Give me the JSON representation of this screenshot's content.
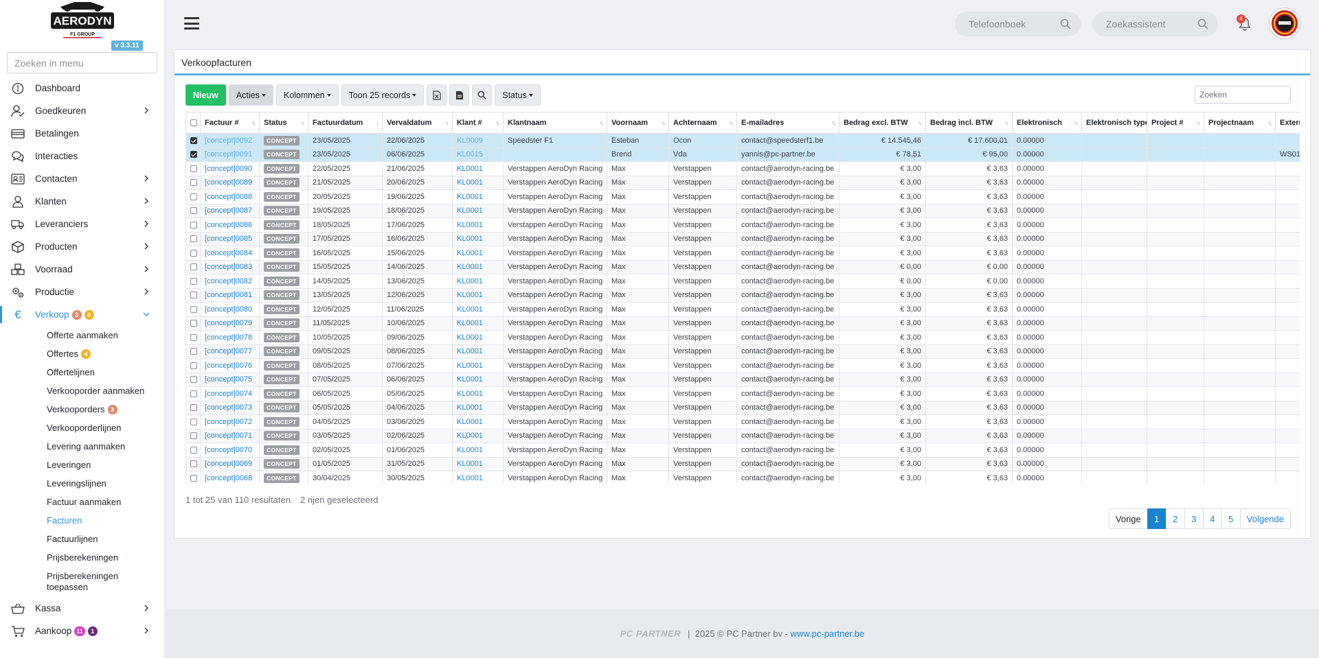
{
  "app": {
    "logo_text": "AERODYN",
    "logo_sub": "F1 GROUP",
    "version": "v 3.3.11",
    "menu_search_placeholder": "Zoeken in menu"
  },
  "sidebar": {
    "items": [
      {
        "label": "Dashboard",
        "icon": "dashboard-icon",
        "chevron": false
      },
      {
        "label": "Goedkeuren",
        "icon": "user-check-icon",
        "chevron": true
      },
      {
        "label": "Betalingen",
        "icon": "card-icon",
        "chevron": false
      },
      {
        "label": "Interacties",
        "icon": "chat-icon",
        "chevron": false
      },
      {
        "label": "Contacten",
        "icon": "contact-card-icon",
        "chevron": true
      },
      {
        "label": "Klanten",
        "icon": "user-icon",
        "chevron": true
      },
      {
        "label": "Leveranciers",
        "icon": "truck-icon",
        "chevron": true
      },
      {
        "label": "Producten",
        "icon": "box-icon",
        "chevron": true
      },
      {
        "label": "Voorraad",
        "icon": "boxes-icon",
        "chevron": true
      },
      {
        "label": "Productie",
        "icon": "gears-icon",
        "chevron": true
      }
    ],
    "verkoop": {
      "label": "Verkoop",
      "badge1": "3",
      "badge2": "4"
    },
    "subitems": [
      {
        "label": "Offerte aanmaken"
      },
      {
        "label": "Offertes",
        "badge": "4",
        "badge_color": "#f0b429"
      },
      {
        "label": "Offertelijnen"
      },
      {
        "label": "Verkooporder aanmaken"
      },
      {
        "label": "Verkooporders",
        "badge": "3",
        "badge_color": "#e08a6b"
      },
      {
        "label": "Verkooporderlijnen"
      },
      {
        "label": "Levering aanmaken"
      },
      {
        "label": "Leveringen"
      },
      {
        "label": "Leveringslijnen"
      },
      {
        "label": "Factuur aanmaken"
      },
      {
        "label": "Facturen",
        "active": true
      },
      {
        "label": "Factuurlijnen"
      },
      {
        "label": "Prijsberekeningen"
      },
      {
        "label": "Prijsberekeningen toepassen"
      }
    ],
    "kassa": {
      "label": "Kassa"
    },
    "aankoop": {
      "label": "Aankoop",
      "badge1": "11",
      "badge2": "1"
    }
  },
  "topbar": {
    "phonebook_placeholder": "Telefoonboek",
    "assistant_placeholder": "Zoekassistent",
    "notification_count": "4"
  },
  "page": {
    "title": "Verkoopfacturen",
    "toolbar": {
      "new": "Nieuw",
      "actions": "Acties",
      "columns": "Kolommen",
      "show": "Toon 25 records",
      "status": "Status"
    },
    "search_placeholder": "Zoeken",
    "columns": [
      "Factuur #",
      "Status",
      "Factuurdatum",
      "Vervaldatum",
      "Klant #",
      "Klantnaam",
      "Voornaam",
      "Achternaam",
      "E-mailadres",
      "Bedrag excl. BTW",
      "Bedrag incl. BTW",
      "Elektronisch",
      "Elektronisch type",
      "Project #",
      "Projectnaam",
      "Externe"
    ],
    "rows": [
      {
        "sel": true,
        "inv": "[concept]0092",
        "status": "CONCEPT",
        "date": "23/05/2025",
        "due": "22/06/2025",
        "client": "KL0009",
        "cname": "Speedster F1",
        "first": "Esteban",
        "last": "Ocon",
        "email": "contact@speedsterf1.be",
        "excl": "€ 14.545,46",
        "incl": "€ 17.600,01",
        "el": "0.00000",
        "ext": ""
      },
      {
        "sel": true,
        "inv": "[concept]0091",
        "status": "CONCEPT",
        "date": "23/05/2025",
        "due": "06/06/2025",
        "client": "KL0015",
        "cname": "",
        "first": "Brend",
        "last": "Vda",
        "email": "yannis@pc-partner.be",
        "excl": "€ 78,51",
        "incl": "€ 95,00",
        "el": "0.00000",
        "ext": "WS01"
      },
      {
        "inv": "[concept]0090",
        "status": "CONCEPT",
        "date": "22/05/2025",
        "due": "21/06/2025",
        "client": "KL0001",
        "cname": "Verstappen AeroDyn Racing",
        "first": "Max",
        "last": "Verstappen",
        "email": "contact@aerodyn-racing.be",
        "excl": "€ 3,00",
        "incl": "€ 3,63",
        "el": "0.00000",
        "ext": ""
      },
      {
        "inv": "[concept]0089",
        "status": "CONCEPT",
        "date": "21/05/2025",
        "due": "20/06/2025",
        "client": "KL0001",
        "cname": "Verstappen AeroDyn Racing",
        "first": "Max",
        "last": "Verstappen",
        "email": "contact@aerodyn-racing.be",
        "excl": "€ 3,00",
        "incl": "€ 3,63",
        "el": "0.00000",
        "ext": ""
      },
      {
        "inv": "[concept]0088",
        "status": "CONCEPT",
        "date": "20/05/2025",
        "due": "19/06/2025",
        "client": "KL0001",
        "cname": "Verstappen AeroDyn Racing",
        "first": "Max",
        "last": "Verstappen",
        "email": "contact@aerodyn-racing.be",
        "excl": "€ 3,00",
        "incl": "€ 3,63",
        "el": "0.00000",
        "ext": ""
      },
      {
        "inv": "[concept]0087",
        "status": "CONCEPT",
        "date": "19/05/2025",
        "due": "18/06/2025",
        "client": "KL0001",
        "cname": "Verstappen AeroDyn Racing",
        "first": "Max",
        "last": "Verstappen",
        "email": "contact@aerodyn-racing.be",
        "excl": "€ 3,00",
        "incl": "€ 3,63",
        "el": "0.00000",
        "ext": ""
      },
      {
        "inv": "[concept]0086",
        "status": "CONCEPT",
        "date": "18/05/2025",
        "due": "17/06/2025",
        "client": "KL0001",
        "cname": "Verstappen AeroDyn Racing",
        "first": "Max",
        "last": "Verstappen",
        "email": "contact@aerodyn-racing.be",
        "excl": "€ 3,00",
        "incl": "€ 3,63",
        "el": "0.00000",
        "ext": ""
      },
      {
        "inv": "[concept]0085",
        "status": "CONCEPT",
        "date": "17/05/2025",
        "due": "16/06/2025",
        "client": "KL0001",
        "cname": "Verstappen AeroDyn Racing",
        "first": "Max",
        "last": "Verstappen",
        "email": "contact@aerodyn-racing.be",
        "excl": "€ 3,00",
        "incl": "€ 3,63",
        "el": "0.00000",
        "ext": ""
      },
      {
        "inv": "[concept]0084",
        "status": "CONCEPT",
        "date": "16/05/2025",
        "due": "15/06/2025",
        "client": "KL0001",
        "cname": "Verstappen AeroDyn Racing",
        "first": "Max",
        "last": "Verstappen",
        "email": "contact@aerodyn-racing.be",
        "excl": "€ 3,00",
        "incl": "€ 3,63",
        "el": "0.00000",
        "ext": ""
      },
      {
        "inv": "[concept]0083",
        "status": "CONCEPT",
        "date": "15/05/2025",
        "due": "14/06/2025",
        "client": "KL0001",
        "cname": "Verstappen AeroDyn Racing",
        "first": "Max",
        "last": "Verstappen",
        "email": "contact@aerodyn-racing.be",
        "excl": "€ 0,00",
        "incl": "€ 0,00",
        "el": "0.00000",
        "ext": ""
      },
      {
        "inv": "[concept]0082",
        "status": "CONCEPT",
        "date": "14/05/2025",
        "due": "13/06/2025",
        "client": "KL0001",
        "cname": "Verstappen AeroDyn Racing",
        "first": "Max",
        "last": "Verstappen",
        "email": "contact@aerodyn-racing.be",
        "excl": "€ 0,00",
        "incl": "€ 0,00",
        "el": "0.00000",
        "ext": ""
      },
      {
        "inv": "[concept]0081",
        "status": "CONCEPT",
        "date": "13/05/2025",
        "due": "12/06/2025",
        "client": "KL0001",
        "cname": "Verstappen AeroDyn Racing",
        "first": "Max",
        "last": "Verstappen",
        "email": "contact@aerodyn-racing.be",
        "excl": "€ 3,00",
        "incl": "€ 3,63",
        "el": "0.00000",
        "ext": ""
      },
      {
        "inv": "[concept]0080",
        "status": "CONCEPT",
        "date": "12/05/2025",
        "due": "11/06/2025",
        "client": "KL0001",
        "cname": "Verstappen AeroDyn Racing",
        "first": "Max",
        "last": "Verstappen",
        "email": "contact@aerodyn-racing.be",
        "excl": "€ 3,00",
        "incl": "€ 3,63",
        "el": "0.00000",
        "ext": ""
      },
      {
        "inv": "[concept]0079",
        "status": "CONCEPT",
        "date": "11/05/2025",
        "due": "10/06/2025",
        "client": "KL0001",
        "cname": "Verstappen AeroDyn Racing",
        "first": "Max",
        "last": "Verstappen",
        "email": "contact@aerodyn-racing.be",
        "excl": "€ 3,00",
        "incl": "€ 3,63",
        "el": "0.00000",
        "ext": ""
      },
      {
        "inv": "[concept]0078",
        "status": "CONCEPT",
        "date": "10/05/2025",
        "due": "09/06/2025",
        "client": "KL0001",
        "cname": "Verstappen AeroDyn Racing",
        "first": "Max",
        "last": "Verstappen",
        "email": "contact@aerodyn-racing.be",
        "excl": "€ 3,00",
        "incl": "€ 3,63",
        "el": "0.00000",
        "ext": ""
      },
      {
        "inv": "[concept]0077",
        "status": "CONCEPT",
        "date": "09/05/2025",
        "due": "08/06/2025",
        "client": "KL0001",
        "cname": "Verstappen AeroDyn Racing",
        "first": "Max",
        "last": "Verstappen",
        "email": "contact@aerodyn-racing.be",
        "excl": "€ 3,00",
        "incl": "€ 3,63",
        "el": "0.00000",
        "ext": ""
      },
      {
        "inv": "[concept]0076",
        "status": "CONCEPT",
        "date": "08/05/2025",
        "due": "07/06/2025",
        "client": "KL0001",
        "cname": "Verstappen AeroDyn Racing",
        "first": "Max",
        "last": "Verstappen",
        "email": "contact@aerodyn-racing.be",
        "excl": "€ 3,00",
        "incl": "€ 3,63",
        "el": "0.00000",
        "ext": ""
      },
      {
        "inv": "[concept]0075",
        "status": "CONCEPT",
        "date": "07/05/2025",
        "due": "06/06/2025",
        "client": "KL0001",
        "cname": "Verstappen AeroDyn Racing",
        "first": "Max",
        "last": "Verstappen",
        "email": "contact@aerodyn-racing.be",
        "excl": "€ 3,00",
        "incl": "€ 3,63",
        "el": "0.00000",
        "ext": ""
      },
      {
        "inv": "[concept]0074",
        "status": "CONCEPT",
        "date": "06/05/2025",
        "due": "05/06/2025",
        "client": "KL0001",
        "cname": "Verstappen AeroDyn Racing",
        "first": "Max",
        "last": "Verstappen",
        "email": "contact@aerodyn-racing.be",
        "excl": "€ 3,00",
        "incl": "€ 3,63",
        "el": "0.00000",
        "ext": ""
      },
      {
        "inv": "[concept]0073",
        "status": "CONCEPT",
        "date": "05/05/2025",
        "due": "04/06/2025",
        "client": "KL0001",
        "cname": "Verstappen AeroDyn Racing",
        "first": "Max",
        "last": "Verstappen",
        "email": "contact@aerodyn-racing.be",
        "excl": "€ 3,00",
        "incl": "€ 3,63",
        "el": "0.00000",
        "ext": ""
      },
      {
        "inv": "[concept]0072",
        "status": "CONCEPT",
        "date": "04/05/2025",
        "due": "03/06/2025",
        "client": "KL0001",
        "cname": "Verstappen AeroDyn Racing",
        "first": "Max",
        "last": "Verstappen",
        "email": "contact@aerodyn-racing.be",
        "excl": "€ 3,00",
        "incl": "€ 3,63",
        "el": "0.00000",
        "ext": ""
      },
      {
        "inv": "[concept]0071",
        "status": "CONCEPT",
        "date": "03/05/2025",
        "due": "02/06/2025",
        "client": "KL0001",
        "cname": "Verstappen AeroDyn Racing",
        "first": "Max",
        "last": "Verstappen",
        "email": "contact@aerodyn-racing.be",
        "excl": "€ 3,00",
        "incl": "€ 3,63",
        "el": "0.00000",
        "ext": ""
      },
      {
        "inv": "[concept]0070",
        "status": "CONCEPT",
        "date": "02/05/2025",
        "due": "01/06/2025",
        "client": "KL0001",
        "cname": "Verstappen AeroDyn Racing",
        "first": "Max",
        "last": "Verstappen",
        "email": "contact@aerodyn-racing.be",
        "excl": "€ 3,00",
        "incl": "€ 3,63",
        "el": "0.00000",
        "ext": ""
      },
      {
        "inv": "[concept]0069",
        "status": "CONCEPT",
        "date": "01/05/2025",
        "due": "31/05/2025",
        "client": "KL0001",
        "cname": "Verstappen AeroDyn Racing",
        "first": "Max",
        "last": "Verstappen",
        "email": "contact@aerodyn-racing.be",
        "excl": "€ 3,00",
        "incl": "€ 3,63",
        "el": "0.00000",
        "ext": ""
      },
      {
        "inv": "[concept]0068",
        "status": "CONCEPT",
        "date": "30/04/2025",
        "due": "30/05/2025",
        "client": "KL0001",
        "cname": "Verstappen AeroDyn Racing",
        "first": "Max",
        "last": "Verstappen",
        "email": "contact@aerodyn-racing.be",
        "excl": "€ 3,00",
        "incl": "€ 3,63",
        "el": "0.00000",
        "ext": ""
      }
    ],
    "result_info": "1 tot 25 van 110 resultaten",
    "selected_info": "2 rijen geselecteerd",
    "pagination": {
      "prev": "Vorige",
      "pages": [
        "1",
        "2",
        "3",
        "4",
        "5"
      ],
      "active": "1",
      "next": "Volgende"
    }
  },
  "footer": {
    "brand": "PC PARTNER",
    "text": "|  2025 © PC Partner bv - ",
    "link": "www.pc-partner.be"
  }
}
